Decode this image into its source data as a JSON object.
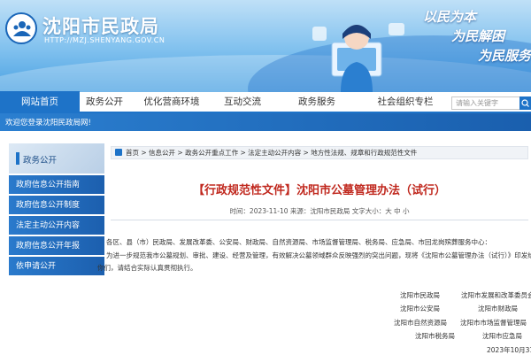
{
  "header": {
    "site_name": "沈阳市民政局",
    "site_url": "HTTP://MZJ.SHENYANG.GOV.CN",
    "slogans": [
      "以民为本",
      "为民解困",
      "为民服务"
    ]
  },
  "nav": {
    "items": [
      {
        "label": "网站首页",
        "active": true
      },
      {
        "label": "政务公开",
        "active": false
      },
      {
        "label": "优化营商环境",
        "active": false
      },
      {
        "label": "互动交流",
        "active": false
      },
      {
        "label": "政务服务",
        "active": false
      },
      {
        "label": "社会组织专栏",
        "active": false
      }
    ],
    "search_placeholder": "请输入关键字"
  },
  "welcome": "欢迎您登录沈阳民政局网!",
  "sidebar": {
    "heading": "政务公开",
    "items": [
      "政府信息公开指南",
      "政府信息公开制度",
      "法定主动公开内容",
      "政府信息公开年报",
      "依申请公开"
    ]
  },
  "breadcrumb": "首页 > 信息公开 > 政务公开重点工作 > 法定主动公开内容 > 地方性法规、规章和行政规范性文件",
  "article": {
    "title": "【行政规范性文件】沈阳市公墓管理办法（试行）",
    "meta": "时间：2023-11-10 来源：沈阳市民政局 文字大小：大 中 小",
    "para1": "各区、县（市）民政局、发展改革委、公安局、财政局、自然资源局、市场监督管理局、税务局、应急局、市回龙岗殡葬服务中心：",
    "para2": "为进一步规范我市公墓规划、审批、建设、经营及管理，有效解决公墓领域群众反映强烈的突出问题，现将《沈阳市公墓管理办法（试行）》印发给",
    "para3": "你们，请结合实际认真贯彻执行。",
    "signatures": [
      "沈阳市民政局",
      "沈阳市发展和改革委员会",
      "沈阳市公安局",
      "沈阳市财政局",
      "沈阳市自然资源局",
      "沈阳市市场监督管理局",
      "沈阳市税务局",
      "沈阳市应急局"
    ],
    "date": "2023年10月31日"
  },
  "colors": {
    "primary": "#1e73c8",
    "title_red": "#c0281e"
  }
}
